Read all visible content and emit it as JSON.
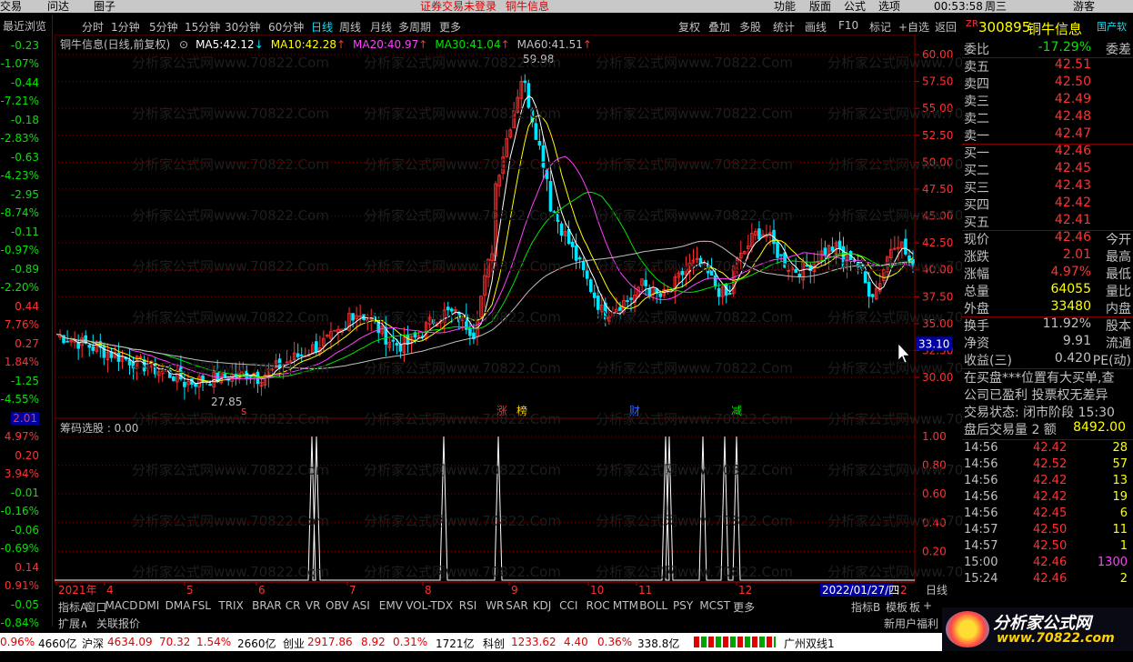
{
  "menu": {
    "items": [
      "交易",
      "问达",
      "圈子"
    ],
    "right": [
      "功能",
      "版面",
      "公式",
      "选项"
    ],
    "notice": "证券交易未登录",
    "stock": "铜牛信息",
    "time": "00:53:58",
    "weekday": "周三",
    "guest": "游客"
  },
  "left_header": "最近浏览",
  "left_values": [
    {
      "v": "-0.23",
      "p": "-1.07%",
      "c": "green"
    },
    {
      "v": "-0.44",
      "p": "-7.21%",
      "c": "green"
    },
    {
      "v": "-0.18",
      "p": "-2.83%",
      "c": "green"
    },
    {
      "v": "-0.63",
      "p": "-4.23%",
      "c": "green"
    },
    {
      "v": "-2.95",
      "p": "-8.74%",
      "c": "green"
    },
    {
      "v": "-0.11",
      "p": "-0.97%",
      "c": "green"
    },
    {
      "v": "-0.89",
      "p": "-2.20%",
      "c": "green"
    },
    {
      "v": "0.44",
      "p": "7.76%",
      "c": "red"
    },
    {
      "v": "0.27",
      "p": "1.84%",
      "c": "red"
    },
    {
      "v": "-1.25",
      "p": "-4.55%",
      "c": "green"
    },
    {
      "v": "2.01",
      "p": "4.97%",
      "c": "red"
    },
    {
      "v": "0.20",
      "p": "3.94%",
      "c": "red"
    },
    {
      "v": "-0.01",
      "p": "-0.16%",
      "c": "green"
    },
    {
      "v": "-0.06",
      "p": "-0.69%",
      "c": "green"
    },
    {
      "v": "0.14",
      "p": "0.91%",
      "c": "red"
    },
    {
      "v": "-0.05",
      "p": "-0.84%",
      "c": "green"
    }
  ],
  "periods": [
    "分时",
    "1分钟",
    "5分钟",
    "15分钟",
    "30分钟",
    "60分钟",
    "日线",
    "周线",
    "月线",
    "多周期",
    "更多"
  ],
  "toolbar_right": [
    "复权",
    "叠加",
    "多股",
    "统计",
    "画线",
    "F10",
    "标记",
    "+自选",
    "返回"
  ],
  "chart_label": "铜牛信息(日线,前复权)",
  "ma": [
    {
      "name": "MA5:",
      "val": "42.12",
      "arrow": "↓",
      "color": "#ffffff",
      "arrow_color": "#00e5ff"
    },
    {
      "name": "MA10:",
      "val": "42.28",
      "arrow": "↑",
      "color": "#ffff00",
      "arrow_color": "#ff3232"
    },
    {
      "name": "MA20:",
      "val": "40.97",
      "arrow": "↑",
      "color": "#ff40ff",
      "arrow_color": "#ff3232"
    },
    {
      "name": "MA30:",
      "val": "41.04",
      "arrow": "↑",
      "color": "#00e600",
      "arrow_color": "#ff3232"
    },
    {
      "name": "MA60:",
      "val": "41.51",
      "arrow": "↑",
      "color": "#c0c0c0",
      "arrow_color": "#ff3232"
    }
  ],
  "price_ticks": [
    "60.00",
    "57.50",
    "55.00",
    "52.50",
    "50.00",
    "47.50",
    "45.00",
    "42.50",
    "40.00",
    "37.50",
    "35.00",
    "32.50",
    "30.00"
  ],
  "high_label": "59.98",
  "low_label": "27.85",
  "cursor_price": "33.10",
  "markers": {
    "s": "s",
    "zhang": "涨",
    "bang": "榜",
    "cai": "财",
    "jian": "减"
  },
  "sub_label": "筹码选股 : 0.00",
  "sub_ticks": [
    "1.00",
    "0.80",
    "0.60",
    "0.40",
    "0.20"
  ],
  "date_axis": [
    "2021年",
    "4",
    "5",
    "6",
    "7",
    "8",
    "9",
    "10",
    "11",
    "12"
  ],
  "date_cursor": "2022/01/27/四",
  "date_right": [
    "2",
    "日线"
  ],
  "indicators": [
    "指标A",
    "窗口",
    "MACD",
    "DMI",
    "DMA",
    "FSL",
    "TRIX",
    "BRAR",
    "CR",
    "VR",
    "OBV",
    "ASI",
    "EMV",
    "VOL-TDX",
    "RSI",
    "WR",
    "SAR",
    "KDJ",
    "CCI",
    "ROC",
    "MTM",
    "BOLL",
    "PSY",
    "MCST",
    "更多"
  ],
  "ind_right": [
    "指标B",
    "模板",
    "板"
  ],
  "expand": [
    "扩展∧",
    "关联报价"
  ],
  "new_user": "新用户福利",
  "quote": {
    "code": "300895",
    "name": "铜牛信息",
    "tag": "国产软",
    "weibi": {
      "l": "委比",
      "v": "-17.29%",
      "r": "委差"
    },
    "asks": [
      {
        "l": "卖五",
        "v": "42.51"
      },
      {
        "l": "卖四",
        "v": "42.50"
      },
      {
        "l": "卖三",
        "v": "42.49"
      },
      {
        "l": "卖二",
        "v": "42.48"
      },
      {
        "l": "卖一",
        "v": "42.47"
      }
    ],
    "bids": [
      {
        "l": "买一",
        "v": "42.46"
      },
      {
        "l": "买二",
        "v": "42.45"
      },
      {
        "l": "买三",
        "v": "42.43"
      },
      {
        "l": "买四",
        "v": "42.42"
      },
      {
        "l": "买五",
        "v": "42.41"
      }
    ],
    "stats": [
      {
        "l": "现价",
        "v": "42.46",
        "r": "今开",
        "c": "red"
      },
      {
        "l": "涨跌",
        "v": "2.01",
        "r": "最高",
        "c": "red"
      },
      {
        "l": "涨幅",
        "v": "4.97%",
        "r": "最低",
        "c": "red"
      },
      {
        "l": "总量",
        "v": "64055",
        "r": "量比",
        "c": "yellow"
      },
      {
        "l": "外盘",
        "v": "33480",
        "r": "内盘",
        "c": "yellow"
      }
    ],
    "stats2": [
      {
        "l": "换手",
        "v": "11.92%",
        "r": "股本"
      },
      {
        "l": "净资",
        "v": "9.91",
        "r": "流通"
      },
      {
        "l": "收益(三)",
        "v": "0.420",
        "r": "PE(动)"
      }
    ],
    "notices": [
      "在买盘***位置有大买单,查",
      "公司已盈利 投票权无差异",
      "交易状态: 闭市阶段 15:30"
    ],
    "after": {
      "l": "盘后交易量 2 额",
      "v": "8492.00"
    },
    "trades": [
      {
        "t": "14:56",
        "p": "42.42",
        "q": "28",
        "c": "yellow"
      },
      {
        "t": "14:56",
        "p": "42.52",
        "q": "57",
        "c": "yellow"
      },
      {
        "t": "14:56",
        "p": "42.42",
        "q": "13",
        "c": "yellow"
      },
      {
        "t": "14:56",
        "p": "42.42",
        "q": "19",
        "c": "yellow"
      },
      {
        "t": "14:56",
        "p": "42.45",
        "q": "6",
        "c": "yellow"
      },
      {
        "t": "14:57",
        "p": "42.50",
        "q": "11",
        "c": "yellow"
      },
      {
        "t": "14:57",
        "p": "42.50",
        "q": "1",
        "c": "yellow"
      },
      {
        "t": "15:00",
        "p": "42.46",
        "q": "1300",
        "c": "mag"
      },
      {
        "t": "15:24",
        "p": "42.46",
        "q": "2",
        "c": "yellow"
      }
    ]
  },
  "statusbar": [
    {
      "t": "0.96%",
      "c": "red"
    },
    {
      "t": "4660亿",
      "c": "black"
    },
    {
      "t": "沪深",
      "c": "black"
    },
    {
      "t": "4634.09",
      "c": "red"
    },
    {
      "t": "70.32",
      "c": "red"
    },
    {
      "t": "1.54%",
      "c": "red"
    },
    {
      "t": "2660亿",
      "c": "black"
    },
    {
      "t": "创业",
      "c": "black"
    },
    {
      "t": "2917.86",
      "c": "red"
    },
    {
      "t": "8.92",
      "c": "red"
    },
    {
      "t": "0.31%",
      "c": "red"
    },
    {
      "t": "1721亿",
      "c": "black"
    },
    {
      "t": "科创",
      "c": "black"
    },
    {
      "t": "1233.62",
      "c": "red"
    },
    {
      "t": "4.40",
      "c": "red"
    },
    {
      "t": "0.36%",
      "c": "red"
    },
    {
      "t": "338.8亿",
      "c": "black"
    },
    {
      "t": "广州双线1",
      "c": "black"
    }
  ],
  "watermark": "分析家公式网www.70822.Com",
  "logo": {
    "text": "分析家公式网",
    "url": "www.70822.com"
  }
}
